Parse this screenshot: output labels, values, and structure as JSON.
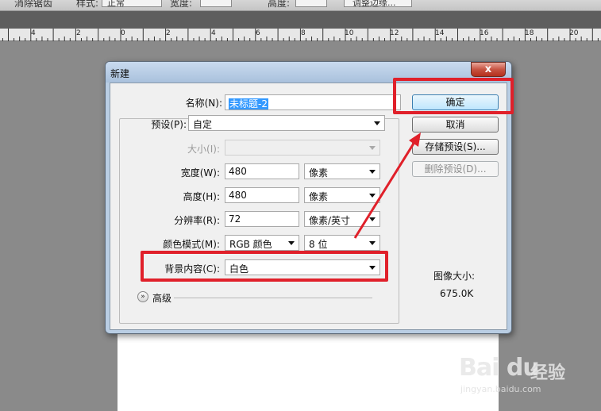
{
  "options_bar": {
    "items": [
      "消除锯齿",
      "样式:",
      "正常",
      "宽度:",
      "高度:",
      "调整边缘..."
    ]
  },
  "ruler": {
    "labels": [
      "4",
      "2",
      "0",
      "2",
      "4",
      "6",
      "8",
      "10",
      "12",
      "14",
      "16",
      "18",
      "20"
    ]
  },
  "dialog": {
    "title": "新建",
    "close_label": "x",
    "name_label": "名称(N):",
    "name_value": "未标题-2",
    "preset_label": "预设(P):",
    "preset_value": "自定",
    "size_label": "大小(I):",
    "size_value": "",
    "width_label": "宽度(W):",
    "width_value": "480",
    "width_unit": "像素",
    "height_label": "高度(H):",
    "height_value": "480",
    "height_unit": "像素",
    "resolution_label": "分辨率(R):",
    "resolution_value": "72",
    "resolution_unit": "像素/英寸",
    "color_mode_label": "颜色模式(M):",
    "color_mode_value": "RGB 颜色",
    "bit_depth_value": "8 位",
    "background_label": "背景内容(C):",
    "background_value": "白色",
    "advanced_label": "高级",
    "advanced_icon": "double-chevron-down-icon",
    "buttons": {
      "ok": "确定",
      "cancel": "取消",
      "save_preset": "存储预设(S)...",
      "delete_preset": "删除预设(D)..."
    },
    "image_size_label": "图像大小:",
    "image_size_value": "675.0K"
  },
  "annotation_color": "#e0202a",
  "watermark": {
    "logo": "Bai du",
    "text": "经验",
    "url": "jingyan.baidu.com"
  }
}
